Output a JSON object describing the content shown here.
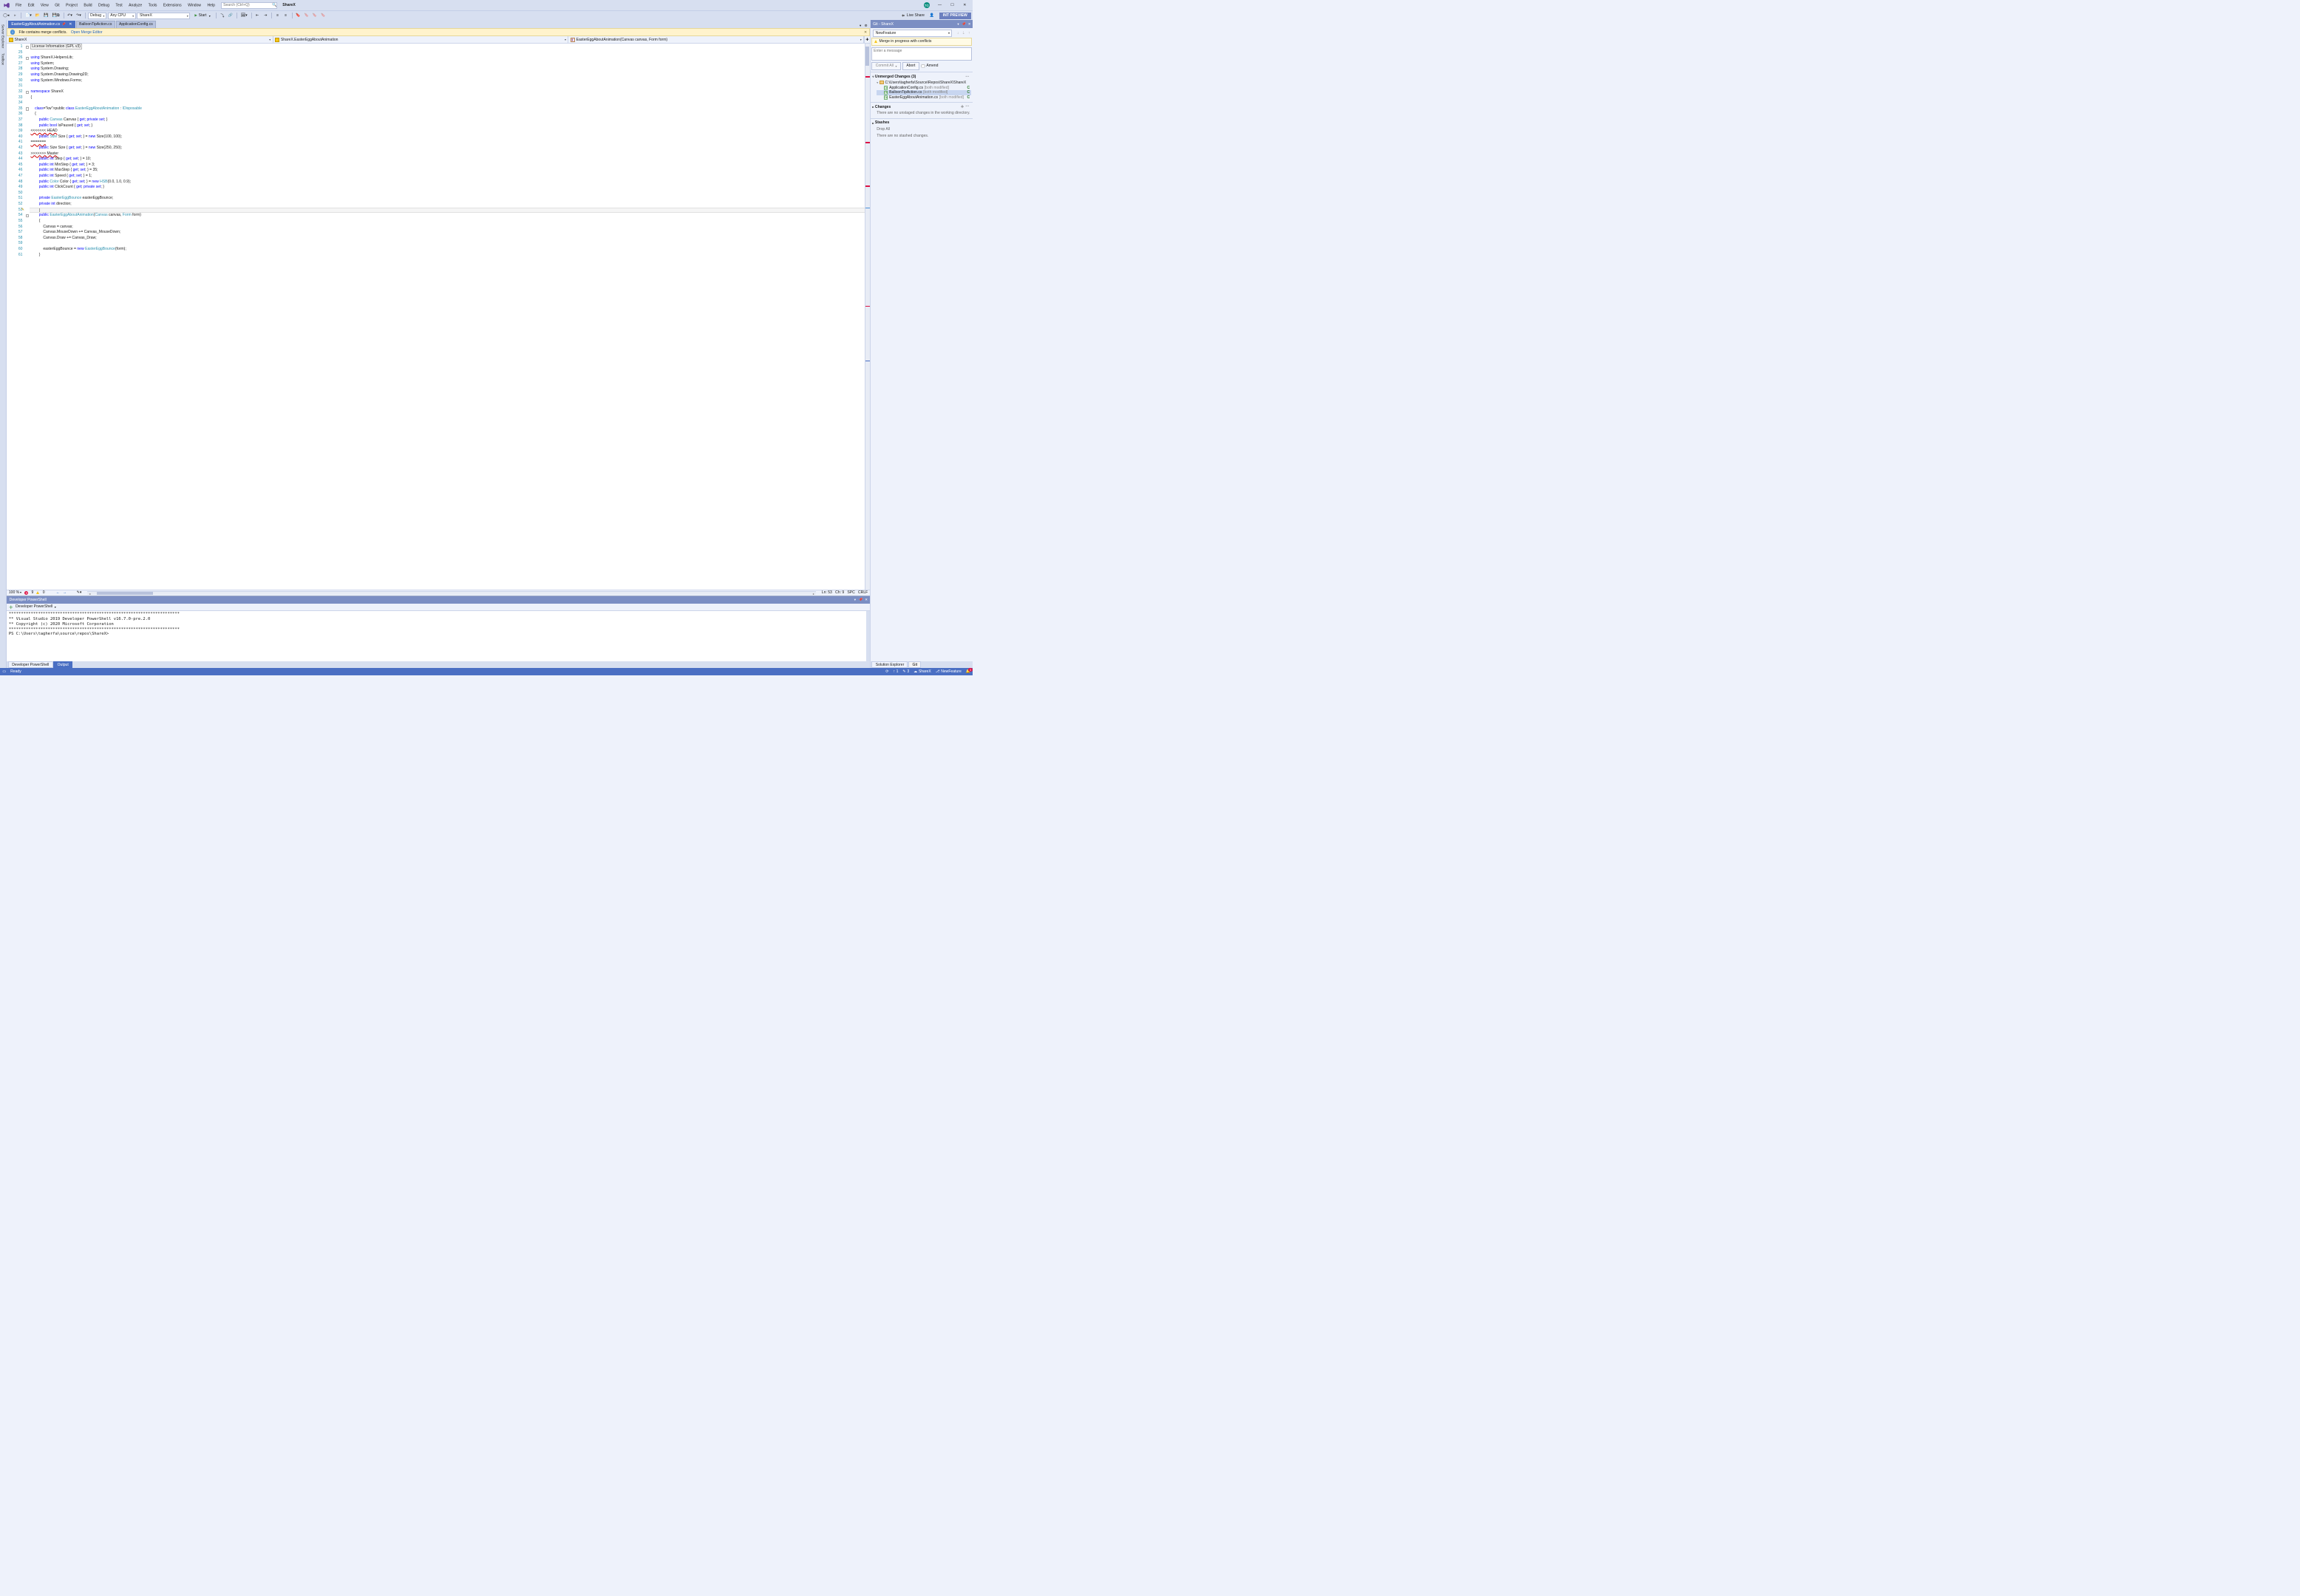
{
  "menu": [
    "File",
    "Edit",
    "View",
    "Git",
    "Project",
    "Build",
    "Debug",
    "Test",
    "Analyze",
    "Tools",
    "Extensions",
    "Window",
    "Help"
  ],
  "search_placeholder": "Search (Ctrl+Q)",
  "solution_name": "ShareX",
  "avatar_initials": "TG",
  "toolbar": {
    "config": "Debug",
    "platform": "Any CPU",
    "startup_project": "ShareX",
    "start_label": "Start",
    "live_share": "Live Share",
    "int_preview": "INT PREVIEW"
  },
  "rail_tabs": [
    "Server Explorer",
    "Toolbox"
  ],
  "doc_tabs": [
    {
      "label": "EasterEggAboutAnimation.cs",
      "active": true,
      "pinned": true
    },
    {
      "label": "BalloonTipAction.cs",
      "active": false
    },
    {
      "label": "ApplicationConfig.cs",
      "active": false
    }
  ],
  "merge_bar": {
    "message": "File contains merge conflicts.",
    "link": "Open Merge Editor"
  },
  "nav": {
    "project": "ShareX",
    "class": "ShareX.EasterEggAboutAnimation",
    "member": "EasterEggAboutAnimation(Canvas canvas, Form form)"
  },
  "code_lines": [
    {
      "n": 1,
      "t": "License Information (GPL v3)",
      "boxed": true,
      "fold": "+"
    },
    {
      "n": 25,
      "t": ""
    },
    {
      "n": 26,
      "t": "using ShareX.HelpersLib;",
      "kw": [
        "using"
      ],
      "fold": "-"
    },
    {
      "n": 27,
      "t": "using System;",
      "kw": [
        "using"
      ]
    },
    {
      "n": 28,
      "t": "using System.Drawing;",
      "kw": [
        "using"
      ]
    },
    {
      "n": 29,
      "t": "using System.Drawing.Drawing2D;",
      "kw": [
        "using"
      ]
    },
    {
      "n": 30,
      "t": "using System.Windows.Forms;",
      "kw": [
        "using"
      ]
    },
    {
      "n": 31,
      "t": ""
    },
    {
      "n": 32,
      "t": "namespace ShareX",
      "kw": [
        "namespace"
      ],
      "fold": "-"
    },
    {
      "n": 33,
      "t": "{"
    },
    {
      "n": 34,
      "t": ""
    },
    {
      "n": 35,
      "t": "    public class EasterEggAboutAnimation : IDisposable",
      "kw": [
        "public",
        "class"
      ],
      "types": [
        "EasterEggAboutAnimation",
        "IDisposable"
      ],
      "fold": "-"
    },
    {
      "n": 36,
      "t": "    {"
    },
    {
      "n": 37,
      "t": "        public Canvas Canvas { get; private set; }",
      "kw": [
        "public",
        "get",
        "private",
        "set"
      ],
      "types": [
        "Canvas"
      ]
    },
    {
      "n": 38,
      "t": "        public bool IsPaused { get; set; }",
      "kw": [
        "public",
        "bool",
        "get",
        "set"
      ]
    },
    {
      "n": 39,
      "t": "<<<<<<< HEAD",
      "conflict": true
    },
    {
      "n": 40,
      "t": "        public Size Size { get; set; } = new Size(100, 100);",
      "kw": [
        "public",
        "get",
        "set",
        "new"
      ],
      "types": [
        "Size",
        "Size"
      ]
    },
    {
      "n": 41,
      "t": "=======",
      "conflict": true
    },
    {
      "n": 42,
      "t": "        public Size Size { get; set; } = new Size(250, 250);",
      "kw": [
        "public",
        "get",
        "set",
        "new"
      ]
    },
    {
      "n": 43,
      "t": ">>>>>>> Master",
      "conflict": true
    },
    {
      "n": 44,
      "t": "        public int Step { get; set; } = 10;",
      "kw": [
        "public",
        "int",
        "get",
        "set"
      ]
    },
    {
      "n": 45,
      "t": "        public int MinStep { get; set; } = 3;",
      "kw": [
        "public",
        "int",
        "get",
        "set"
      ]
    },
    {
      "n": 46,
      "t": "        public int MaxStep { get; set; } = 35;",
      "kw": [
        "public",
        "int",
        "get",
        "set"
      ]
    },
    {
      "n": 47,
      "t": "        public int Speed { get; set; } = 1;",
      "kw": [
        "public",
        "int",
        "get",
        "set"
      ]
    },
    {
      "n": 48,
      "t": "        public Color Color { get; set; } = new HSB(0.0, 1.0, 0.9);",
      "kw": [
        "public",
        "get",
        "set",
        "new"
      ],
      "types": [
        "Color",
        "HSB"
      ]
    },
    {
      "n": 49,
      "t": "        public int ClickCount { get; private set; }",
      "kw": [
        "public",
        "int",
        "get",
        "private",
        "set"
      ]
    },
    {
      "n": 50,
      "t": ""
    },
    {
      "n": 51,
      "t": "        private EasterEggBounce easterEggBounce;",
      "kw": [
        "private"
      ],
      "types": [
        "EasterEggBounce"
      ]
    },
    {
      "n": 52,
      "t": "        private int direction;",
      "kw": [
        "private",
        "int"
      ]
    },
    {
      "n": 53,
      "t": "        |",
      "current": true,
      "editmark": true
    },
    {
      "n": 54,
      "t": "        public EasterEggAboutAnimation(Canvas canvas, Form form)",
      "kw": [
        "public"
      ],
      "types": [
        "EasterEggAboutAnimation",
        "Canvas",
        "Form"
      ],
      "fold": "-"
    },
    {
      "n": 55,
      "t": "        {"
    },
    {
      "n": 56,
      "t": "            Canvas = canvas;"
    },
    {
      "n": 57,
      "t": "            Canvas.MouseDown += Canvas_MouseDown;"
    },
    {
      "n": 58,
      "t": "            Canvas.Draw += Canvas_Draw;"
    },
    {
      "n": 59,
      "t": ""
    },
    {
      "n": 60,
      "t": "            easterEggBounce = new EasterEggBounce(form);",
      "kw": [
        "new"
      ],
      "types": [
        "EasterEggBounce"
      ]
    },
    {
      "n": 61,
      "t": "        }"
    }
  ],
  "editor_status": {
    "zoom": "100 %",
    "errors": "9",
    "warnings": "0",
    "ln": "Ln: 53",
    "ch": "Ch: 9",
    "enc": "SPC",
    "eol": "CRLF"
  },
  "powershell": {
    "title": "Developer PowerShell",
    "toolbar_label": "Developer PowerShell",
    "lines": [
      "**********************************************************************",
      "** Visual Studio 2019 Developer PowerShell v16.7.0-pre.2.0",
      "** Copyright (c) 2020 Microsoft Corporation",
      "**********************************************************************",
      "PS C:\\Users\\tagherfa\\source\\repos\\ShareX>"
    ],
    "tabs": [
      "Developer PowerShell",
      "Output"
    ]
  },
  "git_panel": {
    "title": "Git - ShareX",
    "branch": "NewFeature",
    "warning": "Merge in progress with conflicts",
    "message_placeholder": "Enter a message",
    "commit_label": "Commit All",
    "abort_label": "Abort",
    "amend_label": "Amend",
    "unmerged": {
      "heading": "Unmerged Changes (3)",
      "path": "C:\\Users\\tagherfa\\Source\\Repos\\ShareX\\ShareX",
      "files": [
        {
          "name": "ApplicationConfig.cs",
          "status": "[both modified]",
          "letter": "C"
        },
        {
          "name": "BalloonTipAction.cs",
          "status": "[both modified]",
          "letter": "C",
          "selected": true
        },
        {
          "name": "EasterEggAboutAnimation.cs",
          "status": "[both modified]",
          "letter": "C"
        }
      ]
    },
    "changes": {
      "heading": "Changes",
      "note": "There are no unstaged changes in the working directory."
    },
    "stashes": {
      "heading": "Stashes",
      "drop": "Drop All",
      "note": "There are no stashed changes."
    },
    "bottom_tabs": [
      "Solution Explorer",
      "Git"
    ]
  },
  "statusbar": {
    "ready": "Ready",
    "up": "1",
    "down": "3",
    "repo": "ShareX",
    "branch": "NewFeature",
    "notifications": "3"
  }
}
